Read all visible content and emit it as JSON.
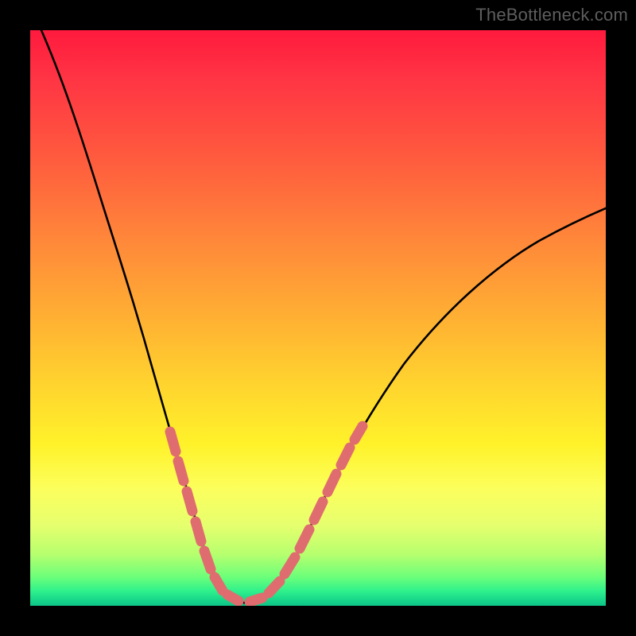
{
  "watermark": "TheBottleneck.com",
  "colors": {
    "frame": "#000000",
    "gradient_top": "#ff1a3d",
    "gradient_mid1": "#ff863a",
    "gradient_mid2": "#ffd52e",
    "gradient_mid3": "#fbff5e",
    "gradient_bottom": "#0ec487",
    "curve": "#000000",
    "dash": "#df6d6f"
  },
  "chart_data": {
    "type": "line",
    "title": "",
    "xlabel": "",
    "ylabel": "",
    "xlim": [
      0,
      100
    ],
    "ylim": [
      0,
      100
    ],
    "series": [
      {
        "name": "bottleneck-curve",
        "x": [
          0,
          4,
          8,
          12,
          15,
          18,
          21,
          24,
          26.5,
          28.5,
          30,
          31.5,
          33,
          34.5,
          36,
          38,
          40,
          44,
          50,
          58,
          66,
          74,
          82,
          90,
          100
        ],
        "y": [
          100,
          87,
          74,
          62,
          53,
          45,
          37,
          29,
          22,
          16,
          10,
          6,
          3,
          1.3,
          0.6,
          0.8,
          2.2,
          7,
          16,
          28,
          38,
          46,
          52,
          57,
          62
        ]
      }
    ],
    "highlight_dashes": {
      "left": {
        "x_range": [
          24,
          33
        ],
        "y_range": [
          3,
          29
        ]
      },
      "right": {
        "x_range": [
          36,
          50
        ],
        "y_range": [
          0.8,
          16
        ]
      }
    },
    "grid": false,
    "legend_position": "none"
  }
}
